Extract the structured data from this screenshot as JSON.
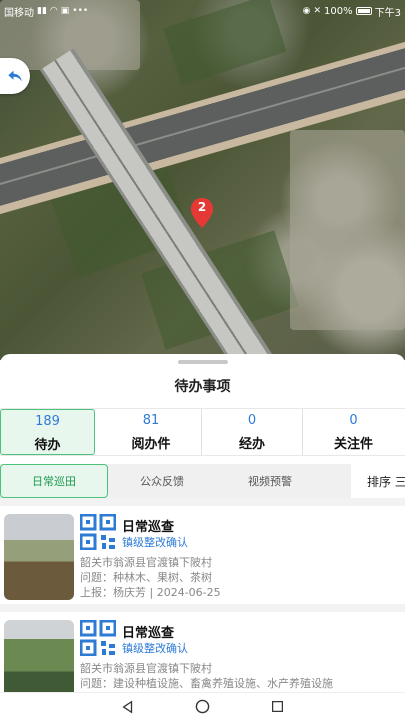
{
  "status_bar": {
    "carrier": "国移动",
    "battery": "100%",
    "time": "下午3"
  },
  "map": {
    "marker_number": "2"
  },
  "sheet": {
    "title": "待办事项"
  },
  "stats": [
    {
      "count": "189",
      "label": "待办"
    },
    {
      "count": "81",
      "label": "阅办件"
    },
    {
      "count": "0",
      "label": "经办"
    },
    {
      "count": "0",
      "label": "关注件"
    }
  ],
  "filters": {
    "tabs": [
      "日常巡田",
      "公众反馈",
      "视频预警"
    ],
    "sort": "排序 三"
  },
  "items": [
    {
      "title": "日常巡查",
      "status": "镇级整改确认",
      "address": "韶关市翁源县官渡镇下陂村",
      "issue": "问题：种林木、果树、茶树",
      "reporter": "上报：杨庆芳 | 2024-06-25"
    },
    {
      "title": "日常巡查",
      "status": "镇级整改确认",
      "address": "韶关市翁源县官渡镇下陂村",
      "issue": "问题：建设种植设施、畜禽养殖设施、水产养殖设施"
    }
  ],
  "colors": {
    "accent_green": "#4cc27a",
    "link_blue": "#2e7bd6",
    "marker_red": "#e53935"
  }
}
